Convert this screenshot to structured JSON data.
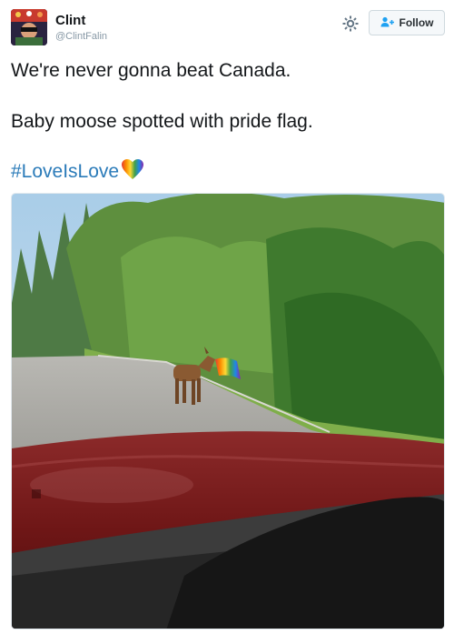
{
  "user": {
    "name": "Clint",
    "handle": "@ClintFalin"
  },
  "follow_button": {
    "label": "Follow"
  },
  "tweet": {
    "line1": "We're never gonna beat Canada.",
    "line2": "Baby moose spotted with pride flag.",
    "hashtag": "#LoveIsLove"
  },
  "icons": {
    "settings": "gear-icon",
    "follow": "add-user-icon",
    "heart": "rainbow-heart-icon"
  },
  "colors": {
    "link": "#2b7bb9",
    "text": "#14171a",
    "muted": "#8899a6",
    "car_hood": "#7a1e1e"
  }
}
